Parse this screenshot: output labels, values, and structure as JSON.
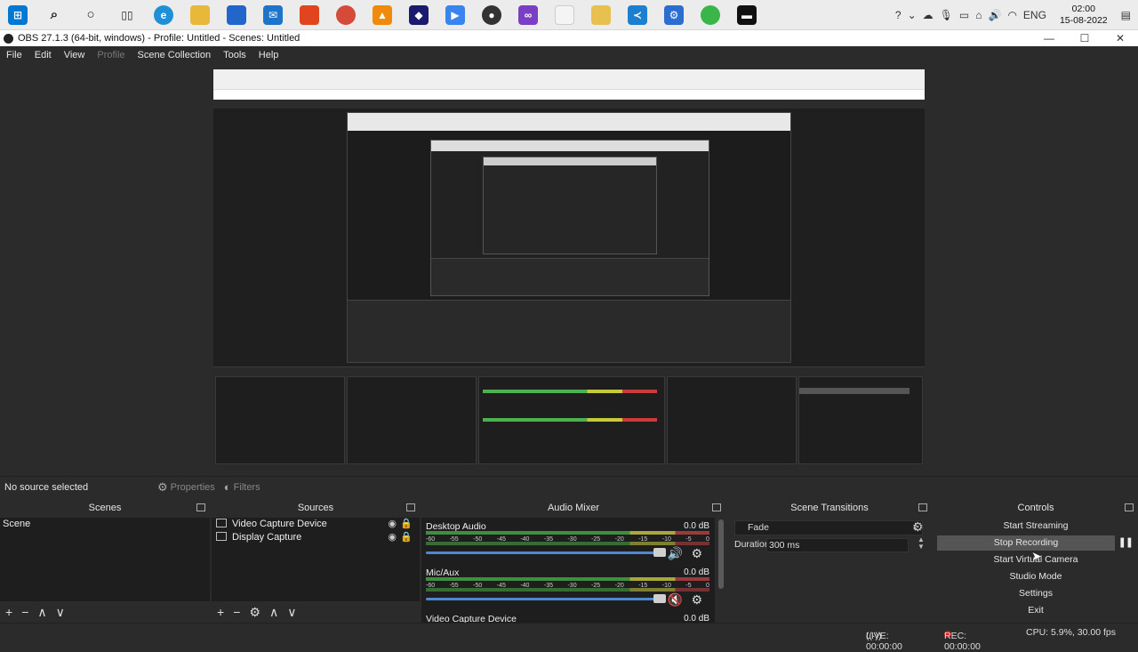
{
  "taskbar": {
    "icons": [
      "windows-start-icon",
      "search-icon",
      "cortana-icon",
      "task-view-icon",
      "edge-icon",
      "file-explorer-icon",
      "store-icon",
      "mail-icon",
      "brave-icon",
      "chrome-icon",
      "vlc-icon",
      "app-icon",
      "zoom-icon",
      "obs-icon",
      "visual-studio-icon",
      "notepad-icon",
      "folder-icon",
      "vscode-icon",
      "settings-app-icon",
      "green-app-icon",
      "terminal-icon"
    ],
    "tray_lang": "ENG",
    "time": "02:00",
    "date": "15-08-2022"
  },
  "window": {
    "title": "OBS 27.1.3 (64-bit, windows) - Profile: Untitled - Scenes: Untitled",
    "minimize": "—",
    "maximize": "☐",
    "close": "✕"
  },
  "menu": [
    "File",
    "Edit",
    "View",
    "Profile",
    "Scene Collection",
    "Tools",
    "Help"
  ],
  "source_toolbar": {
    "status": "No source selected",
    "properties": "Properties",
    "filters": "Filters"
  },
  "scenes": {
    "title": "Scenes",
    "items": [
      "Scene"
    ]
  },
  "sources": {
    "title": "Sources",
    "items": [
      "Video Capture Device",
      "Display Capture"
    ]
  },
  "mixer": {
    "title": "Audio Mixer",
    "ticks": [
      "-60",
      "-55",
      "-50",
      "-45",
      "-40",
      "-35",
      "-30",
      "-25",
      "-20",
      "-15",
      "-10",
      "-5",
      "0"
    ],
    "channels": [
      {
        "name": "Desktop Audio",
        "db": "0.0 dB",
        "volume": 0.98
      },
      {
        "name": "Mic/Aux",
        "db": "0.0 dB",
        "volume": 0.98
      },
      {
        "name": "Video Capture Device",
        "db": "0.0 dB"
      }
    ]
  },
  "transitions": {
    "title": "Scene Transitions",
    "selected": "Fade",
    "duration_label": "Duration",
    "duration_value": "300 ms"
  },
  "controls": {
    "title": "Controls",
    "buttons": [
      "Start Streaming",
      "Stop Recording",
      "Start Virtual Camera",
      "Studio Mode",
      "Settings",
      "Exit"
    ]
  },
  "status": {
    "live": "LIVE: 00:00:00",
    "rec": "REC: 00:00:00",
    "cpu": "CPU: 5.9%, 30.00 fps"
  },
  "colors": {
    "accent": "#4a8ad4",
    "recording": "#c81e1e",
    "panel": "#1e1e1e",
    "background": "#2b2b2b"
  }
}
